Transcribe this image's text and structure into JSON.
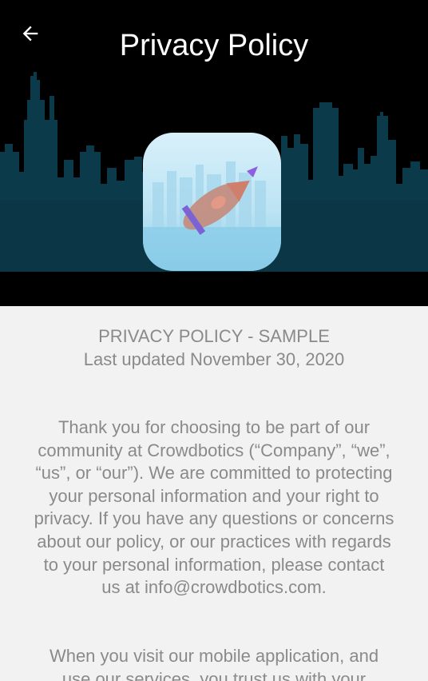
{
  "header": {
    "title": "Privacy Policy",
    "back_icon": "arrow-left-icon"
  },
  "hero": {
    "background": "city-skyline-silhouette",
    "logo": "app-logo-rocket-icon"
  },
  "colors": {
    "header_bg": "#000000",
    "skyline": "#0b3a4a",
    "page_bg": "#f2f2f2",
    "body_text": "#8a8a8a",
    "title_text": "#ffffff"
  },
  "document": {
    "heading_line1": "PRIVACY POLICY - SAMPLE",
    "heading_line2": "Last updated November 30, 2020",
    "paragraph1_lines": [
      "Thank you for choosing to be part of our",
      "community at Crowdbotics (“Company”, “we”,",
      "“us”, or “our”). We are committed to protecting",
      "your personal information and your right to",
      "privacy. If you have any questions or concerns",
      "about our policy, or our practices with regards",
      "to your personal information, please contact",
      "us at info@crowdbotics.com."
    ],
    "paragraph2_lines": [
      "When you visit our mobile application, and",
      "use our services, you trust us with your"
    ]
  }
}
